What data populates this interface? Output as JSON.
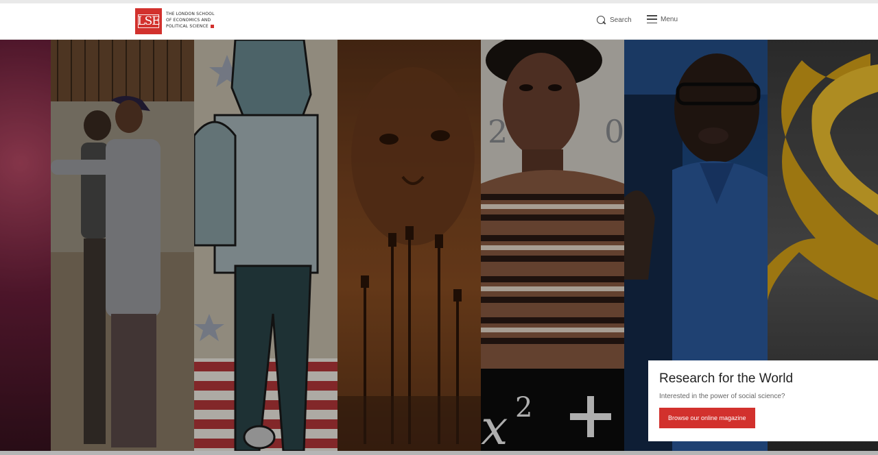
{
  "header": {
    "logo_mark": "LSE",
    "logo_line1": "THE LONDON SCHOOL",
    "logo_line2": "OF ECONOMICS AND",
    "logo_line3": "POLITICAL SCIENCE",
    "search_label": "Search",
    "menu_label": "Menu"
  },
  "hero": {
    "title": "Research for the World",
    "subtitle": "Interested in the power of social science?",
    "cta_label": "Browse our online magazine"
  },
  "colors": {
    "brand_red": "#d2312d",
    "header_bg": "#ffffff",
    "panel_bg": "#ffffff"
  }
}
